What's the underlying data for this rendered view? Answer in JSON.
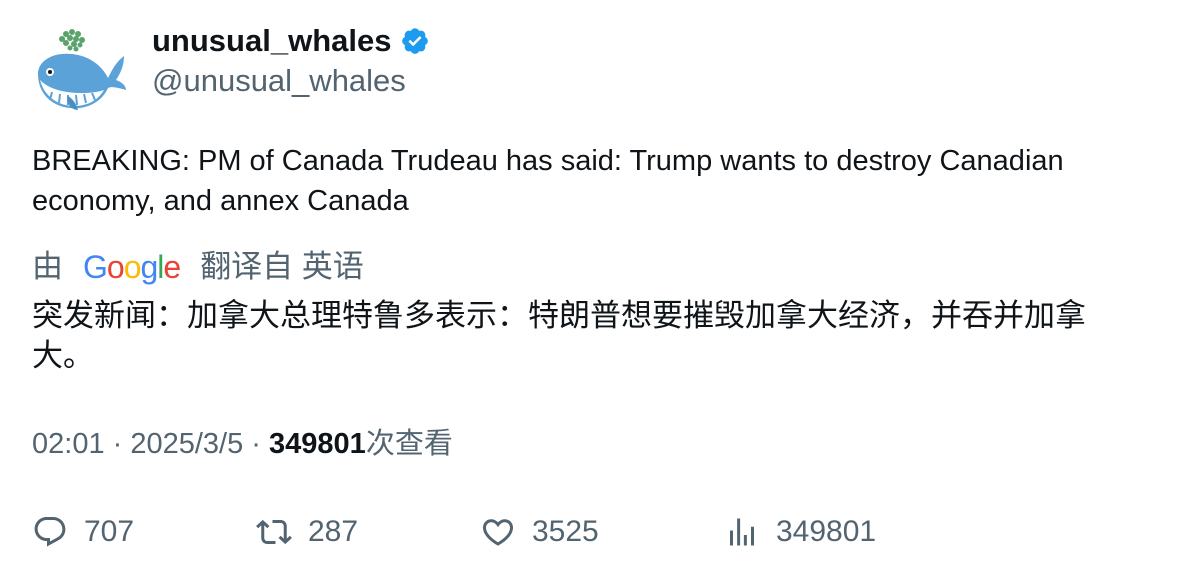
{
  "author": {
    "display_name": "unusual_whales",
    "handle": "@unusual_whales",
    "verified": true,
    "avatar_icon": "whale-icon"
  },
  "tweet": {
    "text": "BREAKING: PM of Canada Trudeau has said: Trump wants to destroy Canadian economy, and annex Canada"
  },
  "translation": {
    "by_label": "由",
    "provider": "Google",
    "from_label": "翻译自 英语",
    "text": "突发新闻：加拿大总理特鲁多表示：特朗普想要摧毁加拿大经济，并吞并加拿大。"
  },
  "meta": {
    "time": "02:01",
    "separator": " · ",
    "date": "2025/3/5",
    "views_count": "349801",
    "views_label": "次查看"
  },
  "actions": {
    "replies": "707",
    "retweets": "287",
    "likes": "3525",
    "views": "349801"
  },
  "colors": {
    "text_primary": "#0f1419",
    "text_secondary": "#536471",
    "verified_badge": "#1d9bf0"
  }
}
